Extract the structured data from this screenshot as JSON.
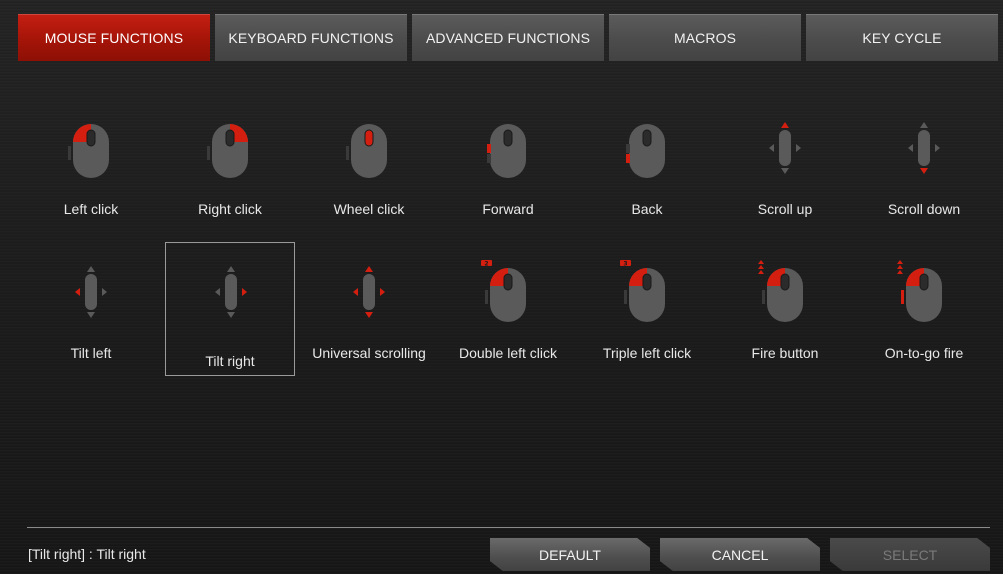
{
  "tabs": [
    {
      "label": "MOUSE FUNCTIONS",
      "active": true
    },
    {
      "label": "KEYBOARD FUNCTIONS",
      "active": false
    },
    {
      "label": "ADVANCED FUNCTIONS",
      "active": false
    },
    {
      "label": "MACROS",
      "active": false
    },
    {
      "label": "KEY CYCLE",
      "active": false
    }
  ],
  "functions": [
    {
      "label": "Left click",
      "icon": "mouse-left-click-icon"
    },
    {
      "label": "Right click",
      "icon": "mouse-right-click-icon"
    },
    {
      "label": "Wheel click",
      "icon": "mouse-wheel-click-icon"
    },
    {
      "label": "Forward",
      "icon": "mouse-forward-icon"
    },
    {
      "label": "Back",
      "icon": "mouse-back-icon"
    },
    {
      "label": "Scroll up",
      "icon": "scroll-up-icon"
    },
    {
      "label": "Scroll down",
      "icon": "scroll-down-icon"
    },
    {
      "label": "Tilt left",
      "icon": "tilt-left-icon"
    },
    {
      "label": "Tilt right",
      "icon": "tilt-right-icon"
    },
    {
      "label": "Universal scrolling",
      "icon": "universal-scrolling-icon"
    },
    {
      "label": "Double left click",
      "icon": "double-left-click-icon"
    },
    {
      "label": "Triple left click",
      "icon": "triple-left-click-icon"
    },
    {
      "label": "Fire button",
      "icon": "fire-button-icon"
    },
    {
      "label": "On-to-go fire",
      "icon": "on-to-go-fire-icon"
    }
  ],
  "selected_function": "Tilt right",
  "status": {
    "text": "[Tilt right] : Tilt right"
  },
  "buttons": {
    "default": "DEFAULT",
    "cancel": "CANCEL",
    "select": "SELECT"
  },
  "colors": {
    "accent": "#d41f10",
    "icon_gray": "#5a5a5a",
    "dark_gray": "#3a3a3a"
  }
}
